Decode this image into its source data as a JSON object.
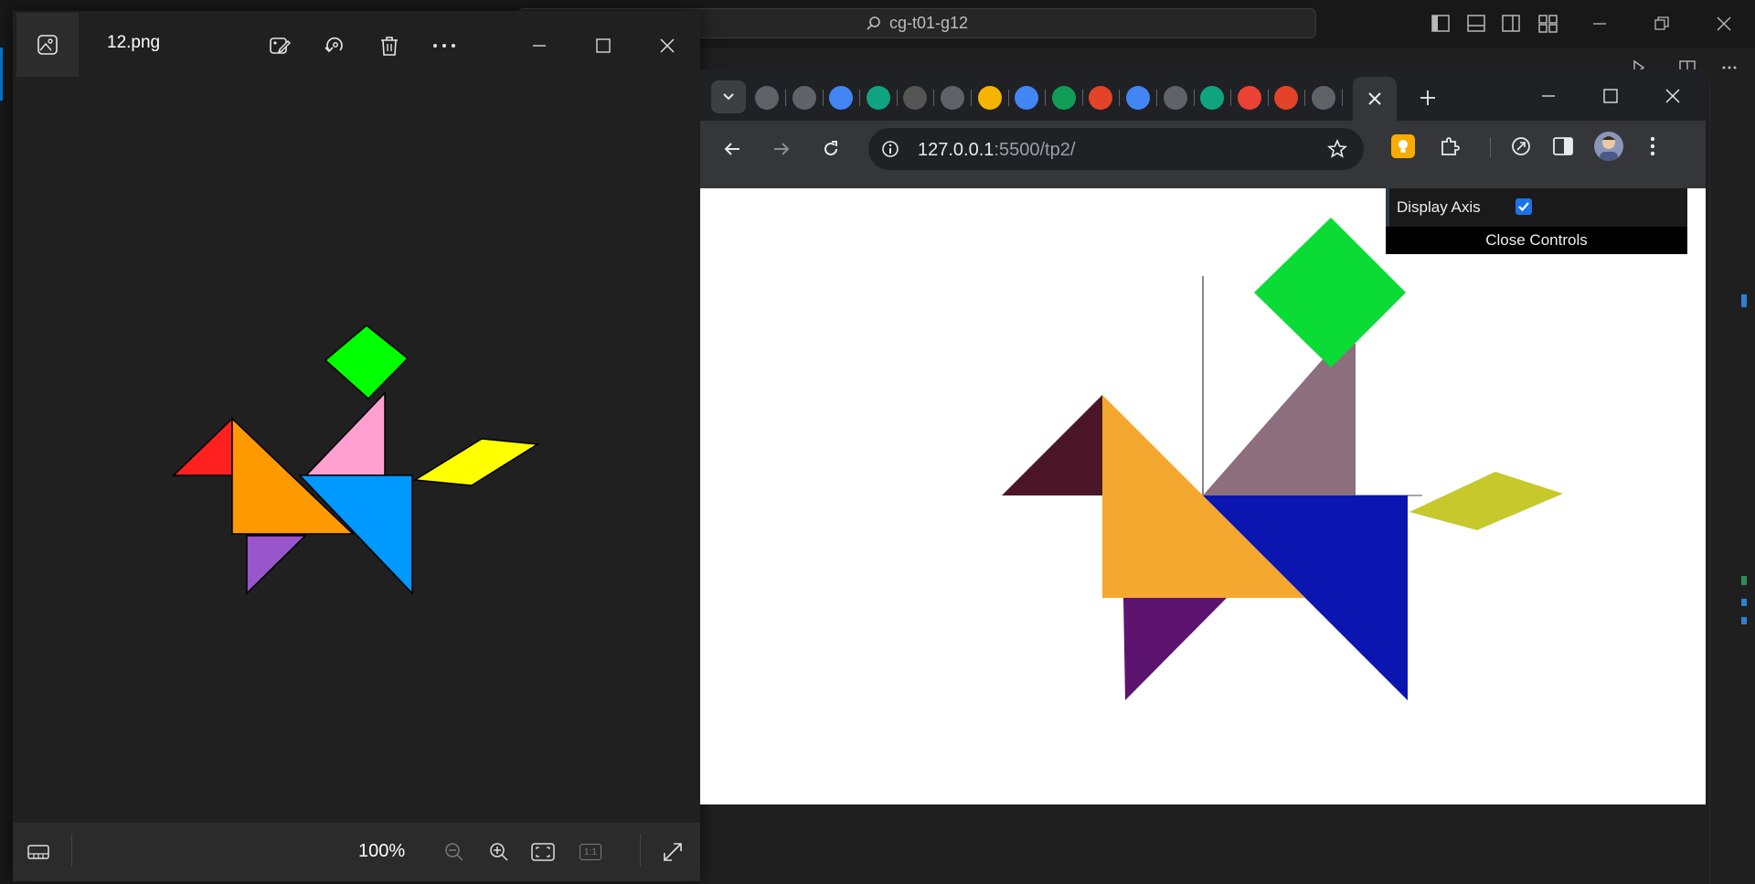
{
  "vscode": {
    "search_text": "cg-t01-g12"
  },
  "photos": {
    "filename": "12.png",
    "zoom": "100%",
    "actual_size_label": "1:1"
  },
  "browser": {
    "url_host": "127.0.0.1",
    "url_path": ":5500/tp2/",
    "tabs": [
      {
        "icon": "globe-icon",
        "color": "#5f6368"
      },
      {
        "icon": "globe-icon",
        "color": "#5f6368"
      },
      {
        "icon": "hexagon-icon",
        "color": "#4285f4"
      },
      {
        "icon": "openai-icon",
        "color": "#10a37f"
      },
      {
        "icon": "openai-icon",
        "color": "#555555"
      },
      {
        "icon": "globe-icon",
        "color": "#5f6368"
      },
      {
        "icon": "m-logo-icon",
        "color": "#f4b400"
      },
      {
        "icon": "docs-icon",
        "color": "#4285f4"
      },
      {
        "icon": "sheets-icon",
        "color": "#0f9d58"
      },
      {
        "icon": "gitlab-icon",
        "color": "#e24329"
      },
      {
        "icon": "docs-icon",
        "color": "#4285f4"
      },
      {
        "icon": "globe-icon",
        "color": "#5f6368"
      },
      {
        "icon": "openai-icon",
        "color": "#10a37f"
      },
      {
        "icon": "gmail-icon",
        "color": "#ea4335"
      },
      {
        "icon": "gitlab-icon",
        "color": "#e24329"
      },
      {
        "icon": "globe-icon",
        "color": "#5f6368"
      }
    ],
    "controls": {
      "display_axis_label": "Display Axis",
      "display_axis_checked": true,
      "close_label": "Close Controls"
    }
  },
  "colors": {
    "tangram_reference": {
      "red": "#ff2020",
      "orange": "#ff9900",
      "pink": "#ffa0d0",
      "green": "#00ff00",
      "yellow": "#ffff00",
      "blue": "#0099ff",
      "purple": "#9955cc"
    },
    "tangram_render": {
      "dark_red": "#4a1628",
      "orange": "#f4a830",
      "mauve": "#8c6e7d",
      "green": "#0adb35",
      "olive_yellow": "#c6c82c",
      "dark_blue": "#0b16b0",
      "purple": "#5c1470"
    }
  }
}
